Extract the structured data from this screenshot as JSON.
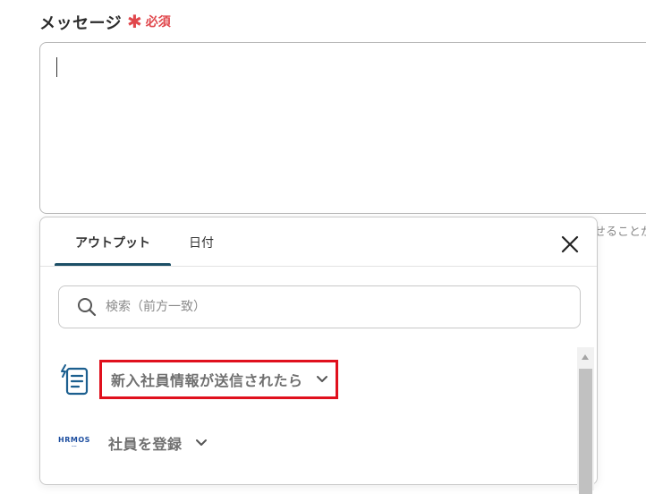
{
  "field": {
    "label": "メッセージ",
    "required_mark": "✱",
    "required_text": "必須",
    "helper_text_partial": "せることが"
  },
  "popover": {
    "tabs": [
      {
        "label": "アウトプット",
        "active": true
      },
      {
        "label": "日付",
        "active": false
      }
    ],
    "search": {
      "placeholder": "検索（前方一致）",
      "value": ""
    },
    "groups": [
      {
        "label": "新入社員情報が送信されたら",
        "icon": "form-trigger-icon",
        "highlighted": true
      },
      {
        "label": "社員を登録",
        "icon": "hrmos-logo",
        "logo_text": "HRMOS"
      }
    ]
  },
  "colors": {
    "required": "#e0474c",
    "tab_underline": "#1c4f66",
    "highlight_border": "#e0101d",
    "trigger_icon": "#1c5f8f",
    "hrmos_brand": "#1e4fa0"
  }
}
